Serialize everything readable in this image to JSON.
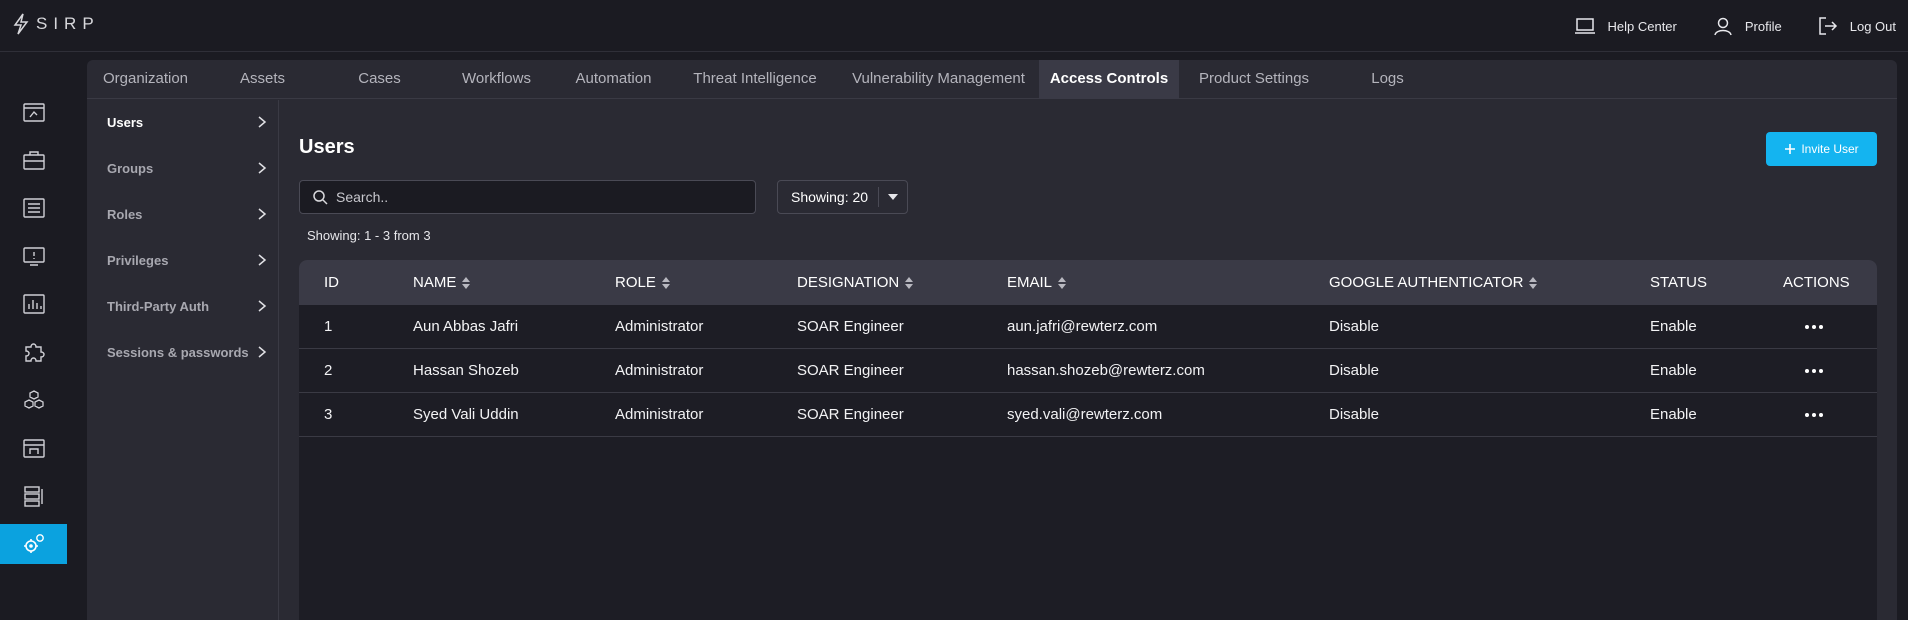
{
  "brand": {
    "name": "SIRP"
  },
  "top_actions": [
    {
      "label": "Help Center",
      "icon": "laptop-icon"
    },
    {
      "label": "Profile",
      "icon": "user-icon"
    },
    {
      "label": "Log Out",
      "icon": "logout-icon"
    }
  ],
  "rail": [
    {
      "icon": "dashboard-icon"
    },
    {
      "icon": "briefcase-icon"
    },
    {
      "icon": "list-icon"
    },
    {
      "icon": "monitor-alert-icon"
    },
    {
      "icon": "bar-chart-icon"
    },
    {
      "icon": "puzzle-icon"
    },
    {
      "icon": "cubes-icon"
    },
    {
      "icon": "gateway-icon"
    },
    {
      "icon": "database-icon"
    },
    {
      "icon": "settings-gear-icon",
      "active": true
    }
  ],
  "tabs": [
    {
      "label": "Organization"
    },
    {
      "label": "Assets"
    },
    {
      "label": "Cases"
    },
    {
      "label": "Workflows"
    },
    {
      "label": "Automation"
    },
    {
      "label": "Threat Intelligence"
    },
    {
      "label": "Vulnerability Management"
    },
    {
      "label": "Access Controls",
      "active": true
    },
    {
      "label": "Product Settings"
    },
    {
      "label": "Logs"
    }
  ],
  "subnav": [
    {
      "label": "Users",
      "active": true
    },
    {
      "label": "Groups"
    },
    {
      "label": "Roles"
    },
    {
      "label": "Privileges"
    },
    {
      "label": "Third-Party Auth"
    },
    {
      "label": "Sessions & passwords"
    }
  ],
  "page": {
    "title": "Users",
    "invite_label": "Invite User",
    "search_placeholder": "Search..",
    "showing_select": "Showing: 20",
    "count_text": "Showing: 1 - 3 from 3"
  },
  "table": {
    "columns": [
      "ID",
      "NAME",
      "ROLE",
      "DESIGNATION",
      "EMAIL",
      "GOOGLE AUTHENTICATOR",
      "STATUS",
      "ACTIONS"
    ],
    "rows": [
      {
        "id": "1",
        "name": "Aun Abbas Jafri",
        "role": "Administrator",
        "designation": "SOAR Engineer",
        "email": "aun.jafri@rewterz.com",
        "google_auth": "Disable",
        "status": "Enable"
      },
      {
        "id": "2",
        "name": "Hassan Shozeb",
        "role": "Administrator",
        "designation": "SOAR Engineer",
        "email": "hassan.shozeb@rewterz.com",
        "google_auth": "Disable",
        "status": "Enable"
      },
      {
        "id": "3",
        "name": "Syed Vali Uddin",
        "role": "Administrator",
        "designation": "SOAR Engineer",
        "email": "syed.vali@rewterz.com",
        "google_auth": "Disable",
        "status": "Enable"
      }
    ]
  },
  "colors": {
    "accent": "#14b4f0",
    "rail_active": "#0ba2df",
    "background": "#1b1b22",
    "panel": "#2a2a33"
  }
}
